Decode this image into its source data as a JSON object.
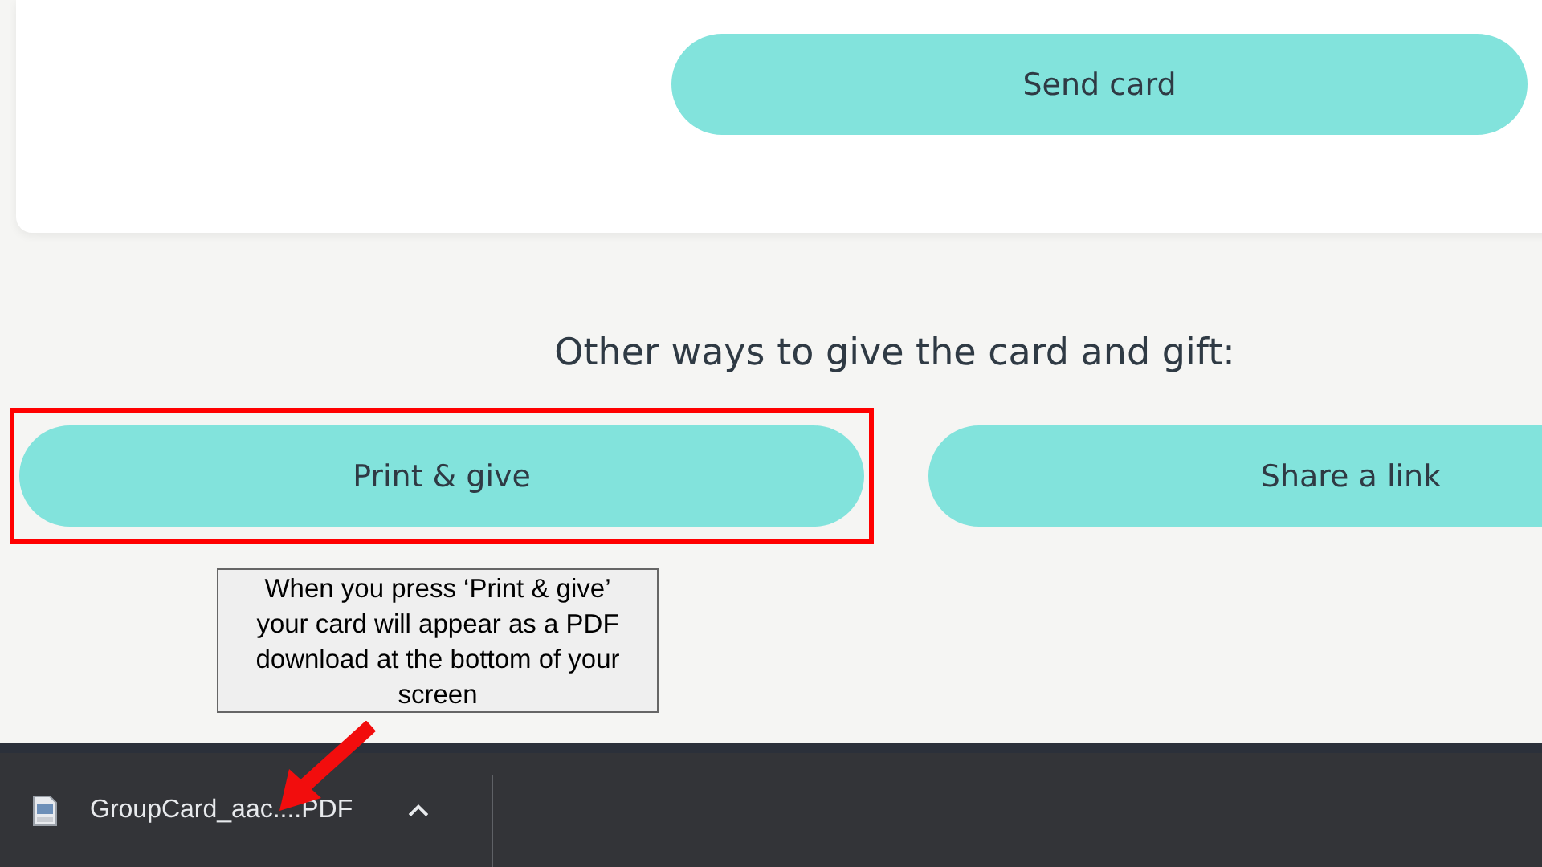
{
  "card": {
    "send_button": "Send card"
  },
  "other_ways": {
    "heading": "Other ways to give the card and gift:",
    "buttons": [
      {
        "label": "Print & give",
        "highlighted": true
      },
      {
        "label": "Share a link",
        "highlighted": false
      }
    ]
  },
  "annotation": {
    "text": "When you press ‘Print & give’ your card will appear as a PDF download at the bottom of your screen"
  },
  "download_bar": {
    "file_name": "GroupCard_aac....PDF"
  }
}
